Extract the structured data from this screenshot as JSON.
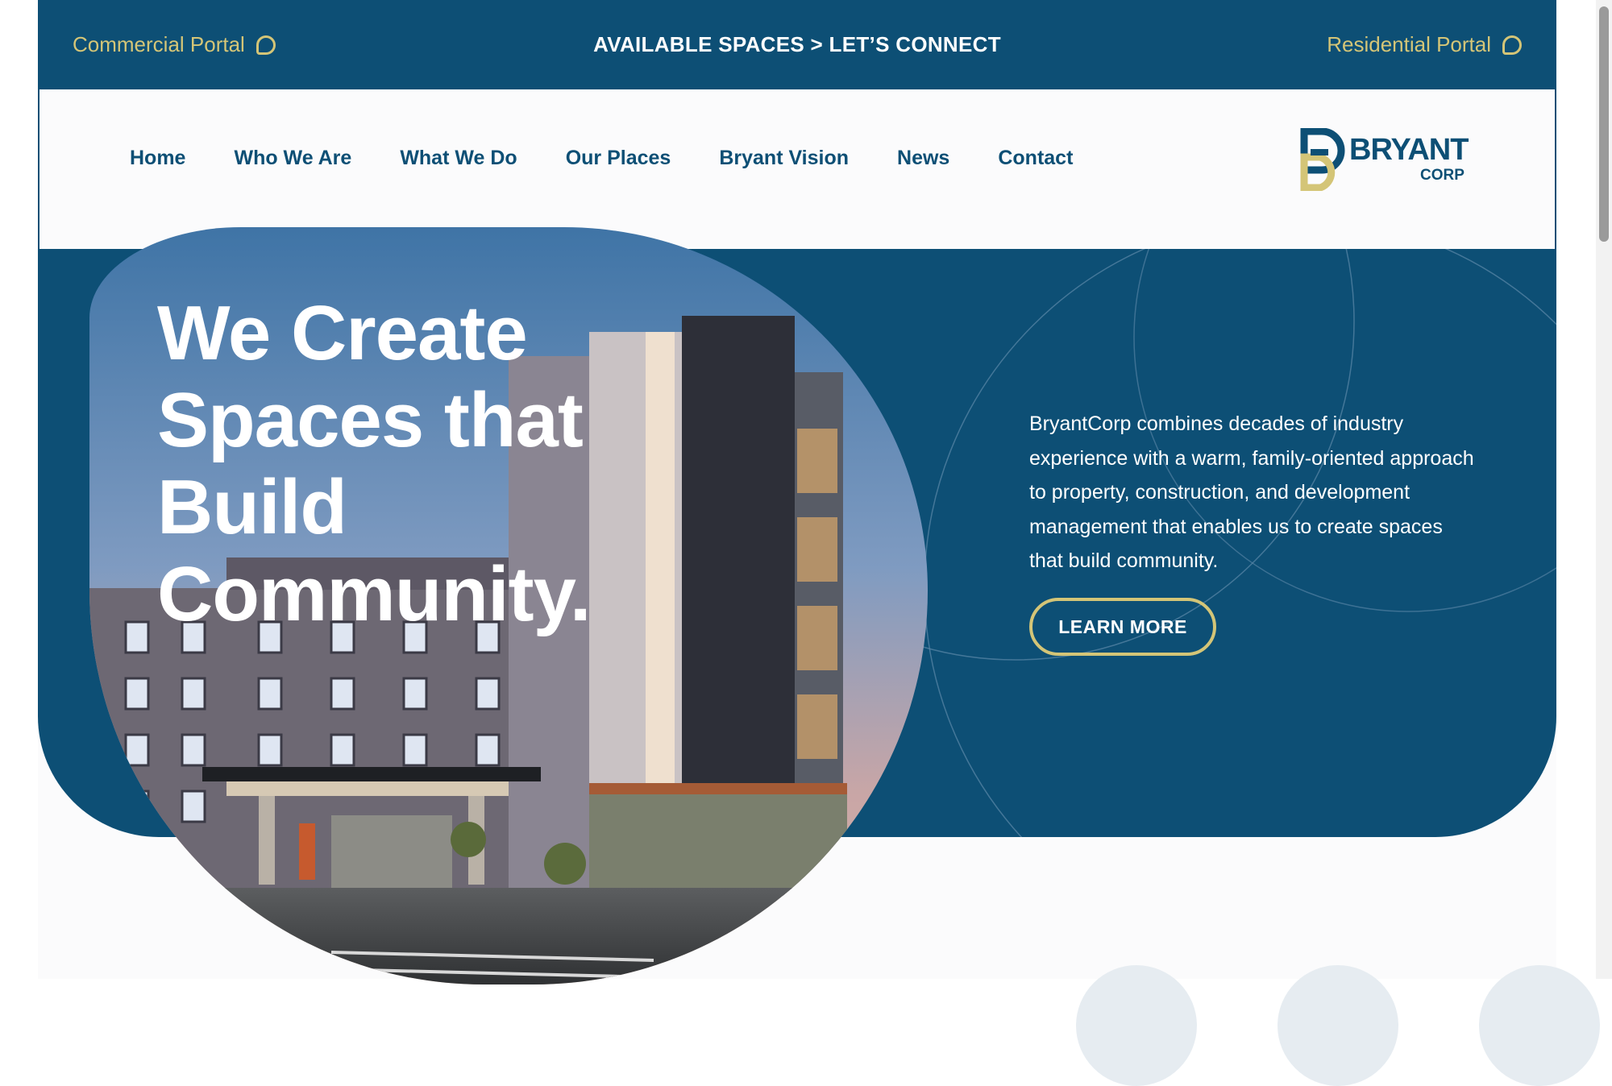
{
  "topbar": {
    "commercial_portal": "Commercial Portal",
    "center_cta": "AVAILABLE SPACES > LET’S CONNECT",
    "residential_portal": "Residential Portal",
    "portal_icon": "chat-bubble-icon"
  },
  "nav": {
    "items": [
      {
        "label": "Home"
      },
      {
        "label": "Who We Are"
      },
      {
        "label": "What We Do"
      },
      {
        "label": "Our Places"
      },
      {
        "label": "Bryant Vision"
      },
      {
        "label": "News"
      },
      {
        "label": "Contact"
      }
    ]
  },
  "logo": {
    "word": "BRYANT",
    "sub": "CORP"
  },
  "hero": {
    "headline_lines": [
      "We Create",
      "Spaces that",
      "Build",
      "Community."
    ],
    "intro": "BryantCorp combines decades of industry experience with a warm, family-oriented approach to property, construction, and development management that enables us to create spaces that build community.",
    "cta": "LEARN MORE"
  },
  "colors": {
    "brand_blue": "#0d4f75",
    "accent_gold": "#d4c577",
    "background": "#fbfbfc"
  }
}
